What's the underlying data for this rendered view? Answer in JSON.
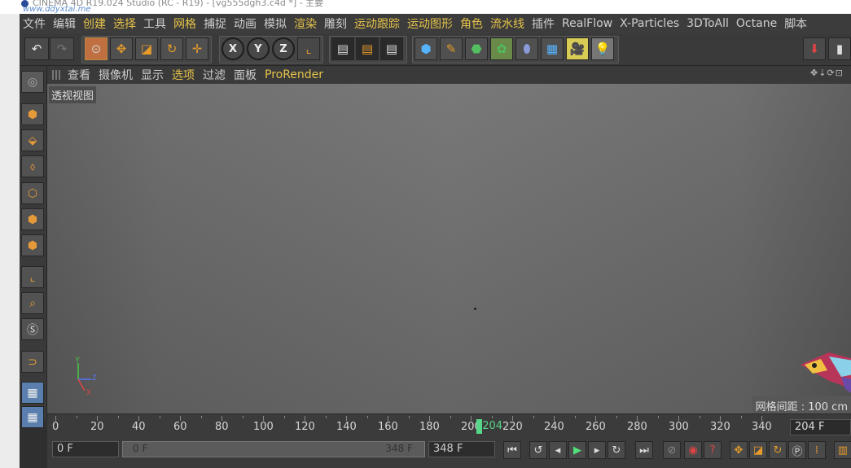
{
  "window": {
    "title": "CINEMA 4D R19.024 Studio (RC - R19) - [vg555dgh3.c4d *] - 主要",
    "watermark": "www.ddyxtai.me"
  },
  "menu": {
    "items": [
      {
        "label": "文件",
        "accent": false
      },
      {
        "label": "编辑",
        "accent": false
      },
      {
        "label": "创建",
        "accent": true
      },
      {
        "label": "选择",
        "accent": true
      },
      {
        "label": "工具",
        "accent": false
      },
      {
        "label": "网格",
        "accent": true
      },
      {
        "label": "捕捉",
        "accent": false
      },
      {
        "label": "动画",
        "accent": false
      },
      {
        "label": "模拟",
        "accent": false
      },
      {
        "label": "渲染",
        "accent": true
      },
      {
        "label": "雕刻",
        "accent": false
      },
      {
        "label": "运动跟踪",
        "accent": true
      },
      {
        "label": "运动图形",
        "accent": true
      },
      {
        "label": "角色",
        "accent": true
      },
      {
        "label": "流水线",
        "accent": true
      },
      {
        "label": "插件",
        "accent": false
      },
      {
        "label": "RealFlow",
        "accent": false
      },
      {
        "label": "X-Particles",
        "accent": false
      },
      {
        "label": "3DToAll",
        "accent": false
      },
      {
        "label": "Octane",
        "accent": false
      },
      {
        "label": "脚本",
        "accent": false
      }
    ]
  },
  "toolbar": {
    "undo_icon": "undo-icon",
    "tools": [
      "live-selection-icon",
      "move-icon",
      "scale-icon",
      "rotate-icon",
      "recent-tool-icon"
    ],
    "axis_locks": [
      "X",
      "Y",
      "Z"
    ],
    "coord_icon": "coordinate-system-icon",
    "render_icons": [
      "render-view-icon",
      "render-picture-viewer-icon",
      "render-settings-icon"
    ],
    "object_icons": [
      "cube-icon",
      "pen-icon",
      "subdivision-icon",
      "cloner-icon",
      "deformer-icon",
      "floor-icon",
      "camera-icon",
      "light-icon"
    ]
  },
  "left_tools": [
    "model-mode-icon",
    "texture-mode-icon",
    "workplane-icon",
    "points-mode-icon",
    "edges-mode-icon",
    "polygons-mode-icon",
    "axis-mode-icon",
    "tweak-mode-icon",
    "solo-mode-icon",
    "snap-icon",
    "workplane-lock-icon",
    "quantize-icon"
  ],
  "viewport_menu": {
    "items": [
      {
        "label": "查看",
        "accent": false
      },
      {
        "label": "摄像机",
        "accent": false
      },
      {
        "label": "显示",
        "accent": false
      },
      {
        "label": "选项",
        "accent": true
      },
      {
        "label": "过滤",
        "accent": false
      },
      {
        "label": "面板",
        "accent": false
      },
      {
        "label": "ProRender",
        "accent": true
      }
    ],
    "nav_icons": "✥⇣⟳⊡"
  },
  "viewport": {
    "label": "透视视图",
    "grid_spacing": "网格间距 : 100 cm",
    "axis": {
      "x": "X",
      "y": "Y",
      "z": "Z"
    }
  },
  "timeline": {
    "ticks": [
      "0",
      "20",
      "40",
      "60",
      "80",
      "100",
      "120",
      "140",
      "160",
      "180",
      "200",
      "220",
      "240",
      "260",
      "280",
      "300",
      "320",
      "340"
    ],
    "playhead_label": "204",
    "playhead_frame": 204,
    "current_frame": "204 F"
  },
  "controls": {
    "start_field": "0 F",
    "range_start": "0 F",
    "range_end": "348 F",
    "end_field": "348 F",
    "transport": [
      "go-to-start-icon",
      "prev-key-icon",
      "prev-frame-icon",
      "play-icon",
      "next-frame-icon",
      "next-key-icon",
      "go-to-end-icon"
    ],
    "keying": [
      "record-disabled-icon",
      "record-icon",
      "autokey-icon"
    ],
    "track_icons": [
      "move-key-icon",
      "scale-key-icon",
      "rotate-key-icon",
      "param-key-icon",
      "pla-key-icon",
      "timeline-icon"
    ]
  },
  "colors": {
    "accent_text": "#e6c34a",
    "playhead": "#55d688",
    "active_tool": "#c07040",
    "toolbar_bg": "#3a3a3a"
  }
}
